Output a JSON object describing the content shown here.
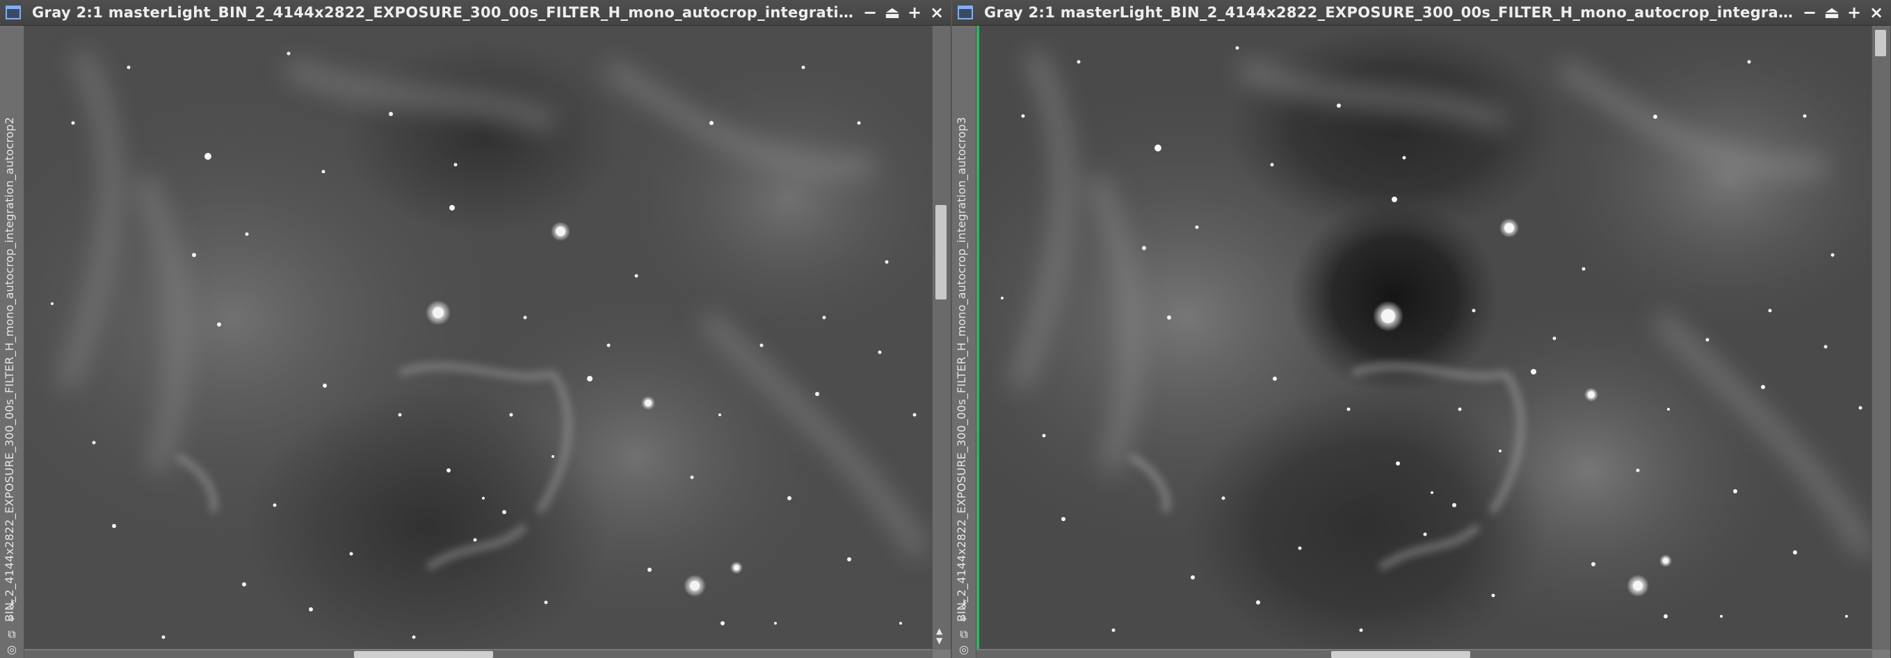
{
  "windows": [
    {
      "title": "Gray 2:1 masterLight_BIN_2_4144x2822_EXPOSURE_300_00s_FILTER_H_mono_autocrop_integration_autocr...",
      "side_label": "BIN_2_4144x2822_EXPOSURE_300_00s_FILTER_H_mono_autocrop_integration_autocrop2",
      "buttons": {
        "minimize": "−",
        "shade": "⏏",
        "maximize": "+",
        "close": "×"
      }
    },
    {
      "title": "Gray 2:1 masterLight_BIN_2_4144x2822_EXPOSURE_300_00s_FILTER_H_mono_autocrop_integration_autocro...",
      "side_label": "BIN_2_4144x2822_EXPOSURE_300_00s_FILTER_H_mono_autocrop_integration_autocrop3",
      "buttons": {
        "minimize": "−",
        "shade": "⏏",
        "maximize": "+",
        "close": "×"
      }
    }
  ],
  "strip_icons": [
    "lock-icon",
    "pin-icon",
    "copy-icon",
    "settings-icon"
  ],
  "colors": {
    "titlebar": "#474747",
    "accent_green": "#16c45a",
    "image_background": "#4b4b4b"
  }
}
